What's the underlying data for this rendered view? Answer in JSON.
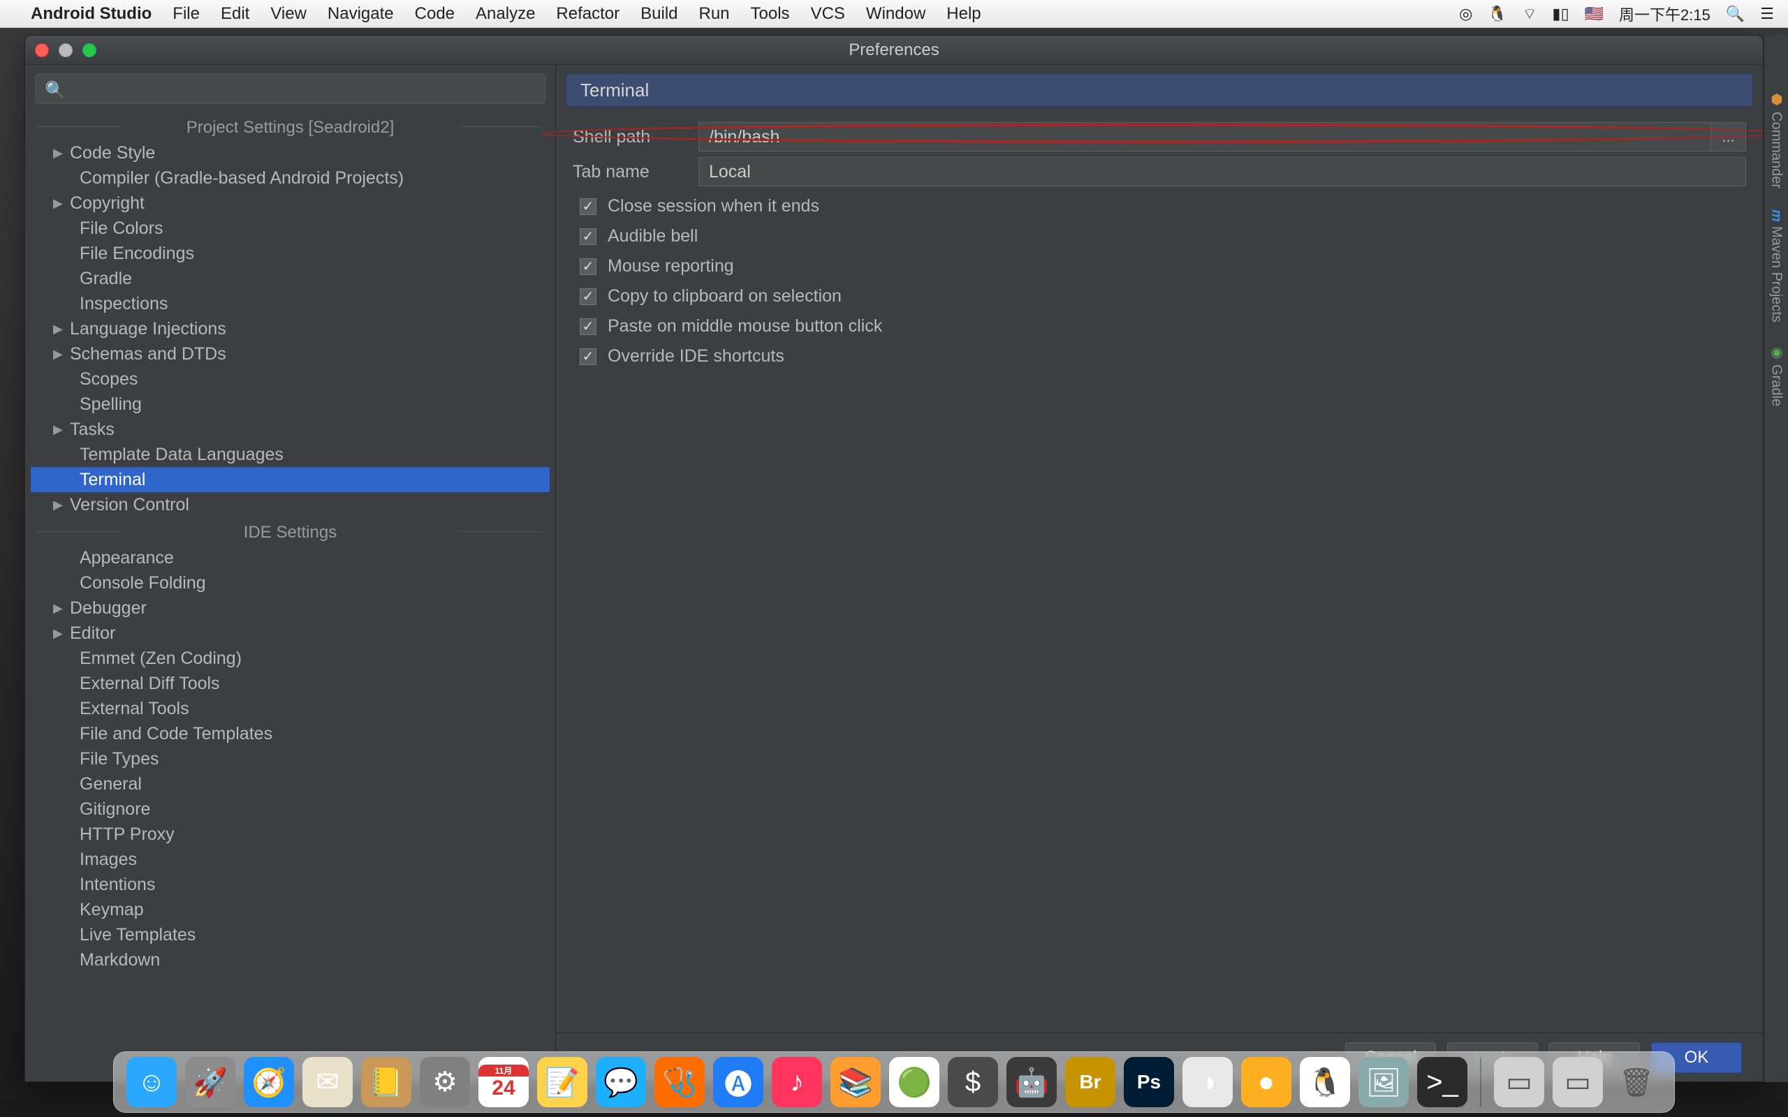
{
  "menubar": {
    "app": "Android Studio",
    "items": [
      "File",
      "Edit",
      "View",
      "Navigate",
      "Code",
      "Analyze",
      "Refactor",
      "Build",
      "Run",
      "Tools",
      "VCS",
      "Window",
      "Help"
    ],
    "clock": "周一下午2:15"
  },
  "window": {
    "title": "Preferences"
  },
  "search": {
    "placeholder": ""
  },
  "sidebar": {
    "section1": "Project Settings [Seadroid2]",
    "section2": "IDE Settings",
    "items1": [
      {
        "label": "Code Style",
        "exp": true
      },
      {
        "label": "Compiler (Gradle-based Android Projects)",
        "exp": false,
        "child": true
      },
      {
        "label": "Copyright",
        "exp": true
      },
      {
        "label": "File Colors",
        "exp": false,
        "child": true
      },
      {
        "label": "File Encodings",
        "exp": false,
        "child": true
      },
      {
        "label": "Gradle",
        "exp": false,
        "child": true
      },
      {
        "label": "Inspections",
        "exp": false,
        "child": true
      },
      {
        "label": "Language Injections",
        "exp": true
      },
      {
        "label": "Schemas and DTDs",
        "exp": true
      },
      {
        "label": "Scopes",
        "exp": false,
        "child": true
      },
      {
        "label": "Spelling",
        "exp": false,
        "child": true
      },
      {
        "label": "Tasks",
        "exp": true
      },
      {
        "label": "Template Data Languages",
        "exp": false,
        "child": true
      },
      {
        "label": "Terminal",
        "exp": false,
        "child": true,
        "selected": true
      },
      {
        "label": "Version Control",
        "exp": true
      }
    ],
    "items2": [
      {
        "label": "Appearance",
        "child": true
      },
      {
        "label": "Console Folding",
        "child": true
      },
      {
        "label": "Debugger",
        "exp": true
      },
      {
        "label": "Editor",
        "exp": true
      },
      {
        "label": "Emmet (Zen Coding)",
        "child": true
      },
      {
        "label": "External Diff Tools",
        "child": true
      },
      {
        "label": "External Tools",
        "child": true
      },
      {
        "label": "File and Code Templates",
        "child": true
      },
      {
        "label": "File Types",
        "child": true
      },
      {
        "label": "General",
        "child": true
      },
      {
        "label": "Gitignore",
        "child": true
      },
      {
        "label": "HTTP Proxy",
        "child": true
      },
      {
        "label": "Images",
        "child": true
      },
      {
        "label": "Intentions",
        "child": true
      },
      {
        "label": "Keymap",
        "child": true
      },
      {
        "label": "Live Templates",
        "child": true
      },
      {
        "label": "Markdown",
        "child": true
      }
    ]
  },
  "panel": {
    "title": "Terminal",
    "shell_path_label": "Shell path",
    "shell_path_value": "/bin/bash",
    "browse": "...",
    "tab_name_label": "Tab name",
    "tab_name_value": "Local",
    "checks": [
      "Close session when it ends",
      "Audible bell",
      "Mouse reporting",
      "Copy to clipboard on selection",
      "Paste on middle mouse button click",
      "Override IDE shortcuts"
    ]
  },
  "buttons": {
    "cancel": "Cancel",
    "apply": "Apply",
    "help": "Help",
    "ok": "OK"
  },
  "rightrail": {
    "tabs": [
      "Commander",
      "Maven Projects",
      "Gradle"
    ]
  },
  "dock": {
    "apps": [
      {
        "name": "finder",
        "bg": "#2aa7ff",
        "glyph": "☺"
      },
      {
        "name": "launchpad",
        "bg": "#8c8c8c",
        "glyph": "🚀"
      },
      {
        "name": "safari",
        "bg": "#1e90ff",
        "glyph": "🧭"
      },
      {
        "name": "mail",
        "bg": "#e8e0c8",
        "glyph": "✉"
      },
      {
        "name": "contacts",
        "bg": "#c99858",
        "glyph": "📒"
      },
      {
        "name": "sysprefs",
        "bg": "#808080",
        "glyph": "⚙"
      },
      {
        "name": "calendar",
        "bg": "#fff",
        "glyph": "24"
      },
      {
        "name": "notes",
        "bg": "#ffd24a",
        "glyph": "📝"
      },
      {
        "name": "messages",
        "bg": "#1db0ff",
        "glyph": "💬"
      },
      {
        "name": "activity",
        "bg": "#ff6d00",
        "glyph": "🩺"
      },
      {
        "name": "appstore",
        "bg": "#1f7cf6",
        "glyph": "🅐"
      },
      {
        "name": "itunes",
        "bg": "#ff355e",
        "glyph": "♪"
      },
      {
        "name": "ibooks",
        "bg": "#ff9e2f",
        "glyph": "📚"
      },
      {
        "name": "chrome",
        "bg": "#fff",
        "glyph": "🟢"
      },
      {
        "name": "sublime",
        "bg": "#4a4a4a",
        "glyph": "$"
      },
      {
        "name": "androidstudio",
        "bg": "#3a3a3a",
        "glyph": "🤖"
      },
      {
        "name": "bridge",
        "bg": "#c79400",
        "glyph": "Br"
      },
      {
        "name": "photoshop",
        "bg": "#001d34",
        "glyph": "Ps"
      },
      {
        "name": "eclipse",
        "bg": "#e8e8e8",
        "glyph": "◑"
      },
      {
        "name": "app2",
        "bg": "#ffb020",
        "glyph": "●"
      },
      {
        "name": "qq",
        "bg": "#fff",
        "glyph": "🐧"
      },
      {
        "name": "photos",
        "bg": "#8aa",
        "glyph": "🖼"
      },
      {
        "name": "terminal",
        "bg": "#2b2b2b",
        "glyph": ">_"
      }
    ],
    "right": [
      {
        "name": "window1",
        "bg": "#d0d0d0",
        "glyph": "▭"
      },
      {
        "name": "window2",
        "bg": "#d0d0d0",
        "glyph": "▭"
      },
      {
        "name": "trash",
        "bg": "transparent",
        "glyph": "🗑"
      }
    ]
  }
}
